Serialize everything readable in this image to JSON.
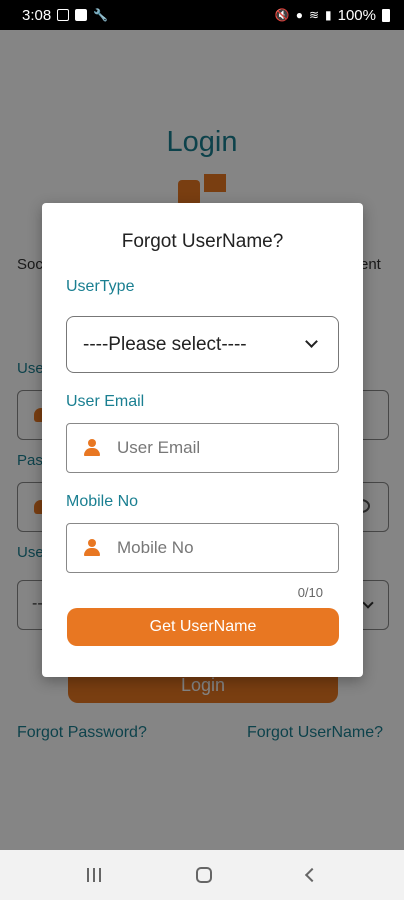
{
  "status_bar": {
    "time": "3:08",
    "battery_text": "100%",
    "icons": [
      "gallery-icon",
      "check-icon",
      "wrench-icon",
      "mute-icon",
      "location-icon",
      "wifi-icon",
      "signal-icon",
      "battery-icon"
    ]
  },
  "background": {
    "title": "Login",
    "subtitle_left": "Soc",
    "subtitle_right": "ent",
    "label_user": "Use",
    "label_pass": "Pas",
    "label_usertype": "Use",
    "select_partial": "--",
    "login_button": "Login",
    "forgot_password": "Forgot Password?",
    "forgot_username": "Forgot UserName?"
  },
  "modal": {
    "title": "Forgot UserName?",
    "usertype_label": "UserType",
    "usertype_value": "----Please select----",
    "email_label": "User Email",
    "email_placeholder": "User Email",
    "mobile_label": "Mobile No",
    "mobile_placeholder": "Mobile No",
    "mobile_counter": "0/10",
    "submit_label": "Get UserName"
  },
  "colors": {
    "accent": "#e87722",
    "teal": "#1a7f91"
  }
}
